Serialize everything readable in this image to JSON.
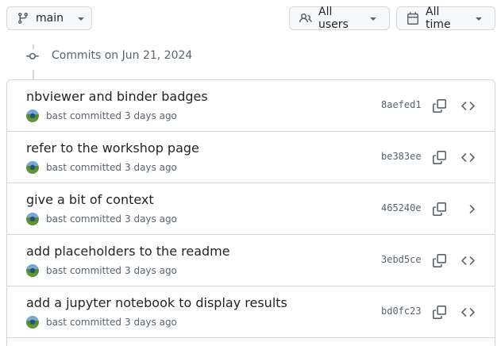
{
  "toolbar": {
    "branch_label": "main",
    "users_label": "All users",
    "time_label": "All time"
  },
  "commit_group": {
    "title": "Commits on Jun 21, 2024"
  },
  "commits": [
    {
      "title": "nbviewer and binder badges",
      "author": "bast",
      "action": "committed",
      "time": "3 days ago",
      "sha": "8aefed1"
    },
    {
      "title": "refer to the workshop page",
      "author": "bast",
      "action": "committed",
      "time": "3 days ago",
      "sha": "be383ee"
    },
    {
      "title": "give a bit of context",
      "author": "bast",
      "action": "committed",
      "time": "3 days ago",
      "sha": "465240e"
    },
    {
      "title": "add placeholders to the readme",
      "author": "bast",
      "action": "committed",
      "time": "3 days ago",
      "sha": "3ebd5ce"
    },
    {
      "title": "add a jupyter notebook to display results",
      "author": "bast",
      "action": "committed",
      "time": "3 days ago",
      "sha": "bd0fc23"
    }
  ],
  "colors": {
    "border": "#d0d7de",
    "text": "#1f2328",
    "muted": "#59636e",
    "button_bg": "#f6f8fa"
  },
  "icons": {
    "branch": "git-branch-icon",
    "people": "people-icon",
    "calendar": "calendar-icon",
    "caret": "triangle-down-icon",
    "commit": "git-commit-icon",
    "copy": "copy-icon",
    "code": "code-icon"
  }
}
